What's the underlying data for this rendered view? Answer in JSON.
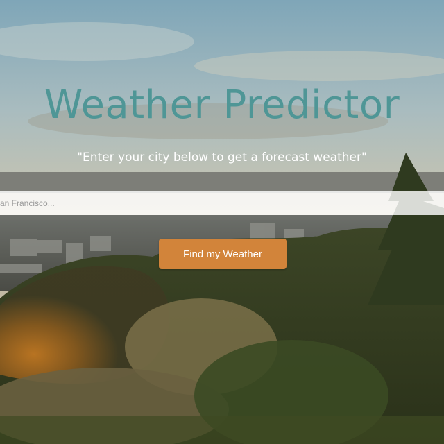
{
  "header": {
    "title": "Weather Predictor",
    "subtitle": "\"Enter your city below to get a forecast weather\""
  },
  "search": {
    "placeholder": "San Francisco...",
    "value": ""
  },
  "actions": {
    "find_label": "Find my Weather"
  },
  "colors": {
    "title": "#4f9696",
    "button": "#d2843a",
    "subtitle": "#ffffff"
  }
}
